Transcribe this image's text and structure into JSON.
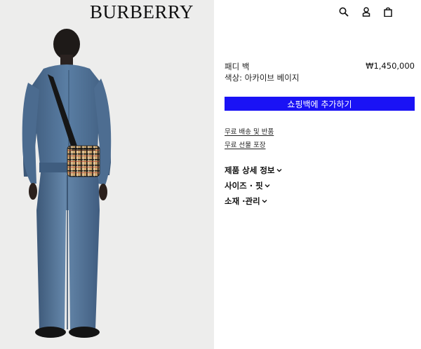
{
  "brand": {
    "logo": "BURBERRY"
  },
  "header": {
    "icons": [
      {
        "name": "search-icon"
      },
      {
        "name": "account-icon"
      },
      {
        "name": "shopping-bag-icon"
      }
    ]
  },
  "product": {
    "name": "패디 백",
    "price": "₩1,450,000",
    "color": "색상: 아카이브 베이지",
    "add_to_bag": "쇼핑백에 추가하기",
    "links": {
      "shipping": "무료 배송 및 반품",
      "gift": "무료 선물 포장"
    },
    "sections": {
      "details": "제품 상세 정보",
      "size": "사이즈 · 핏",
      "material": "소재 ·관리"
    }
  },
  "colors": {
    "accent": "#1a12f5",
    "hero_bg": "#ededec",
    "denim": "#4a6a8e",
    "check": "#c9a26a"
  }
}
